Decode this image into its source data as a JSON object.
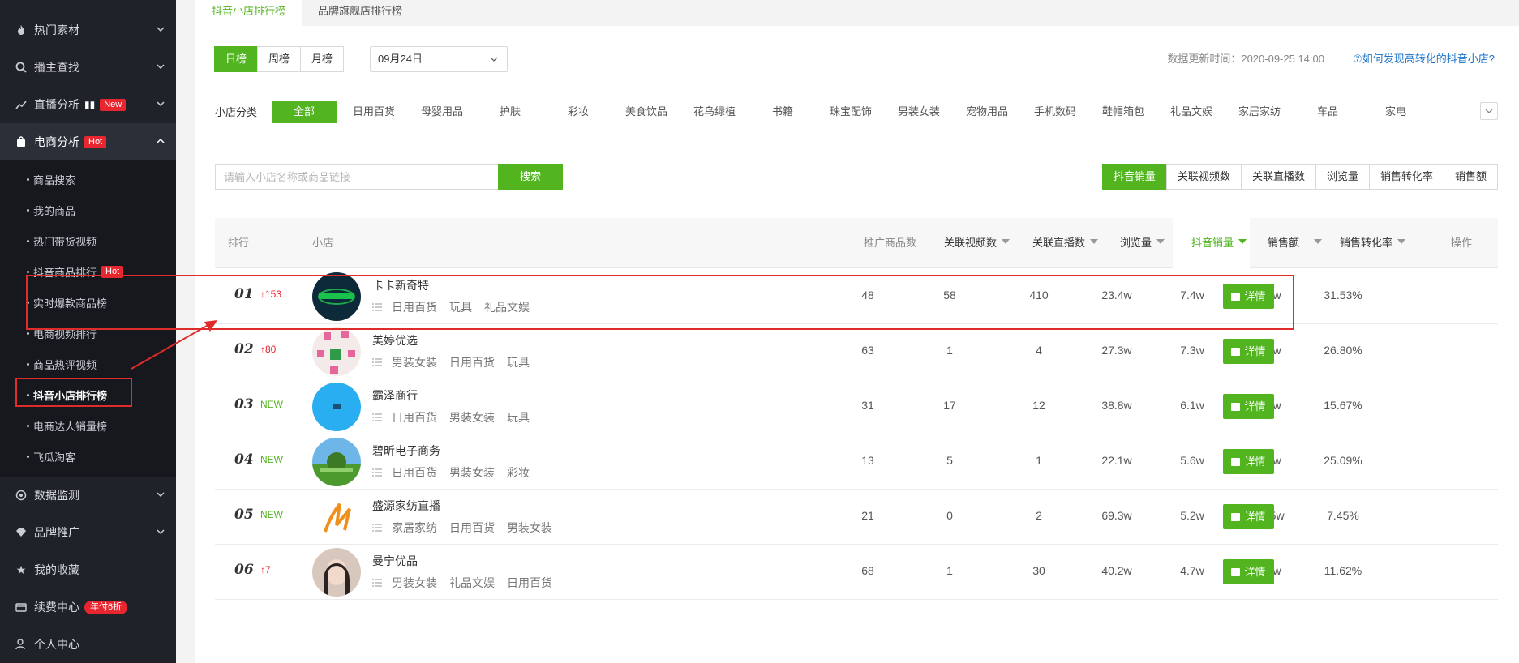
{
  "sidebar": {
    "items_top": [
      {
        "label": "热门素材",
        "icon": "fire-icon"
      },
      {
        "label": "播主查找",
        "icon": "search-icon"
      },
      {
        "label": "直播分析",
        "icon": "chart-icon",
        "badge": "New"
      },
      {
        "label": "电商分析",
        "icon": "bag-icon",
        "badge": "Hot"
      }
    ],
    "sub_items": [
      {
        "label": "商品搜索"
      },
      {
        "label": "我的商品"
      },
      {
        "label": "热门带货视频"
      },
      {
        "label": "抖音商品排行",
        "badge": "Hot"
      },
      {
        "label": "实时爆款商品榜"
      },
      {
        "label": "电商视频排行"
      },
      {
        "label": "商品热评视频"
      },
      {
        "label": "抖音小店排行榜"
      },
      {
        "label": "电商达人销量榜"
      },
      {
        "label": "飞瓜淘客"
      }
    ],
    "items_bottom": [
      {
        "label": "数据监测",
        "icon": "monitor-icon"
      },
      {
        "label": "品牌推广",
        "icon": "diamond-icon"
      },
      {
        "label": "我的收藏",
        "icon": "star-icon"
      },
      {
        "label": "续费中心",
        "icon": "card-icon",
        "badge": "年付6折"
      },
      {
        "label": "个人中心",
        "icon": "user-icon"
      }
    ]
  },
  "tabs": [
    "抖音小店排行榜",
    "品牌旗舰店排行榜"
  ],
  "period": [
    "日榜",
    "周榜",
    "月榜"
  ],
  "date": "09月24日",
  "update_time": "数据更新时间：2020-09-25 14:00",
  "help_link": "⑦如何发现高转化的抖音小店?",
  "category_label": "小店分类",
  "categories": [
    "全部",
    "日用百货",
    "母婴用品",
    "护肤",
    "彩妆",
    "美食饮品",
    "花鸟绿植",
    "书籍",
    "珠宝配饰",
    "男装女装",
    "宠物用品",
    "手机数码",
    "鞋帽箱包",
    "礼品文娱",
    "家居家纺",
    "车品",
    "家电"
  ],
  "search": {
    "placeholder": "请输入小店名称或商品链接",
    "button": "搜索"
  },
  "sort_tabs": [
    "抖音销量",
    "关联视频数",
    "关联直播数",
    "浏览量",
    "销售转化率",
    "销售额"
  ],
  "table": {
    "headers": {
      "rank": "排行",
      "shop": "小店",
      "products": "推广商品数",
      "videos": "关联视频数",
      "lives": "关联直播数",
      "views": "浏览量",
      "sales": "抖音销量",
      "revenue": "销售额",
      "conv": "销售转化率",
      "action": "操作"
    },
    "detail_label": "详情",
    "rows": [
      {
        "rank": "01",
        "change": "↑153",
        "change_type": "up",
        "name": "卡卡新奇特",
        "tags": [
          "日用百货",
          "玩具",
          "礼品文娱"
        ],
        "products": "48",
        "videos": "58",
        "lives": "410",
        "views": "23.4w",
        "sales": "7.4w",
        "revenue": "73.9w",
        "conv": "31.53%",
        "avatar_color": "#0d2a3a"
      },
      {
        "rank": "02",
        "change": "↑80",
        "change_type": "up",
        "name": "美婷优选",
        "tags": [
          "男装女装",
          "日用百货",
          "玩具"
        ],
        "products": "63",
        "videos": "1",
        "lives": "4",
        "views": "27.3w",
        "sales": "7.3w",
        "revenue": "73.5w",
        "conv": "26.80%",
        "avatar_color": "#f5eaea"
      },
      {
        "rank": "03",
        "change": "NEW",
        "change_type": "new",
        "name": "霸泽商行",
        "tags": [
          "日用百货",
          "男装女装",
          "玩具"
        ],
        "products": "31",
        "videos": "17",
        "lives": "12",
        "views": "38.8w",
        "sales": "6.1w",
        "revenue": "60.9w",
        "conv": "15.67%",
        "avatar_color": "#29aef2"
      },
      {
        "rank": "04",
        "change": "NEW",
        "change_type": "new",
        "name": "碧昕电子商务",
        "tags": [
          "日用百货",
          "男装女装",
          "彩妆"
        ],
        "products": "13",
        "videos": "5",
        "lives": "1",
        "views": "22.1w",
        "sales": "5.6w",
        "revenue": "55.1w",
        "conv": "25.09%",
        "avatar_color": "#3f8fd0"
      },
      {
        "rank": "05",
        "change": "NEW",
        "change_type": "new",
        "name": "盛源家纺直播",
        "tags": [
          "家居家纺",
          "日用百货",
          "男装女装"
        ],
        "products": "21",
        "videos": "0",
        "lives": "2",
        "views": "69.3w",
        "sales": "5.2w",
        "revenue": "657.5w",
        "conv": "7.45%",
        "avatar_color": "#ffffff"
      },
      {
        "rank": "06",
        "change": "↑7",
        "change_type": "up",
        "name": "曼宁优品",
        "tags": [
          "男装女装",
          "礼品文娱",
          "日用百货"
        ],
        "products": "68",
        "videos": "1",
        "lives": "30",
        "views": "40.2w",
        "sales": "4.7w",
        "revenue": "93.0w",
        "conv": "11.62%",
        "avatar_color": "#d8c7bd"
      }
    ]
  },
  "colors": {
    "accent": "#52b520",
    "sidebar": "#1f2229",
    "badge": "#e8262f",
    "highlight": "#e02b2b"
  }
}
